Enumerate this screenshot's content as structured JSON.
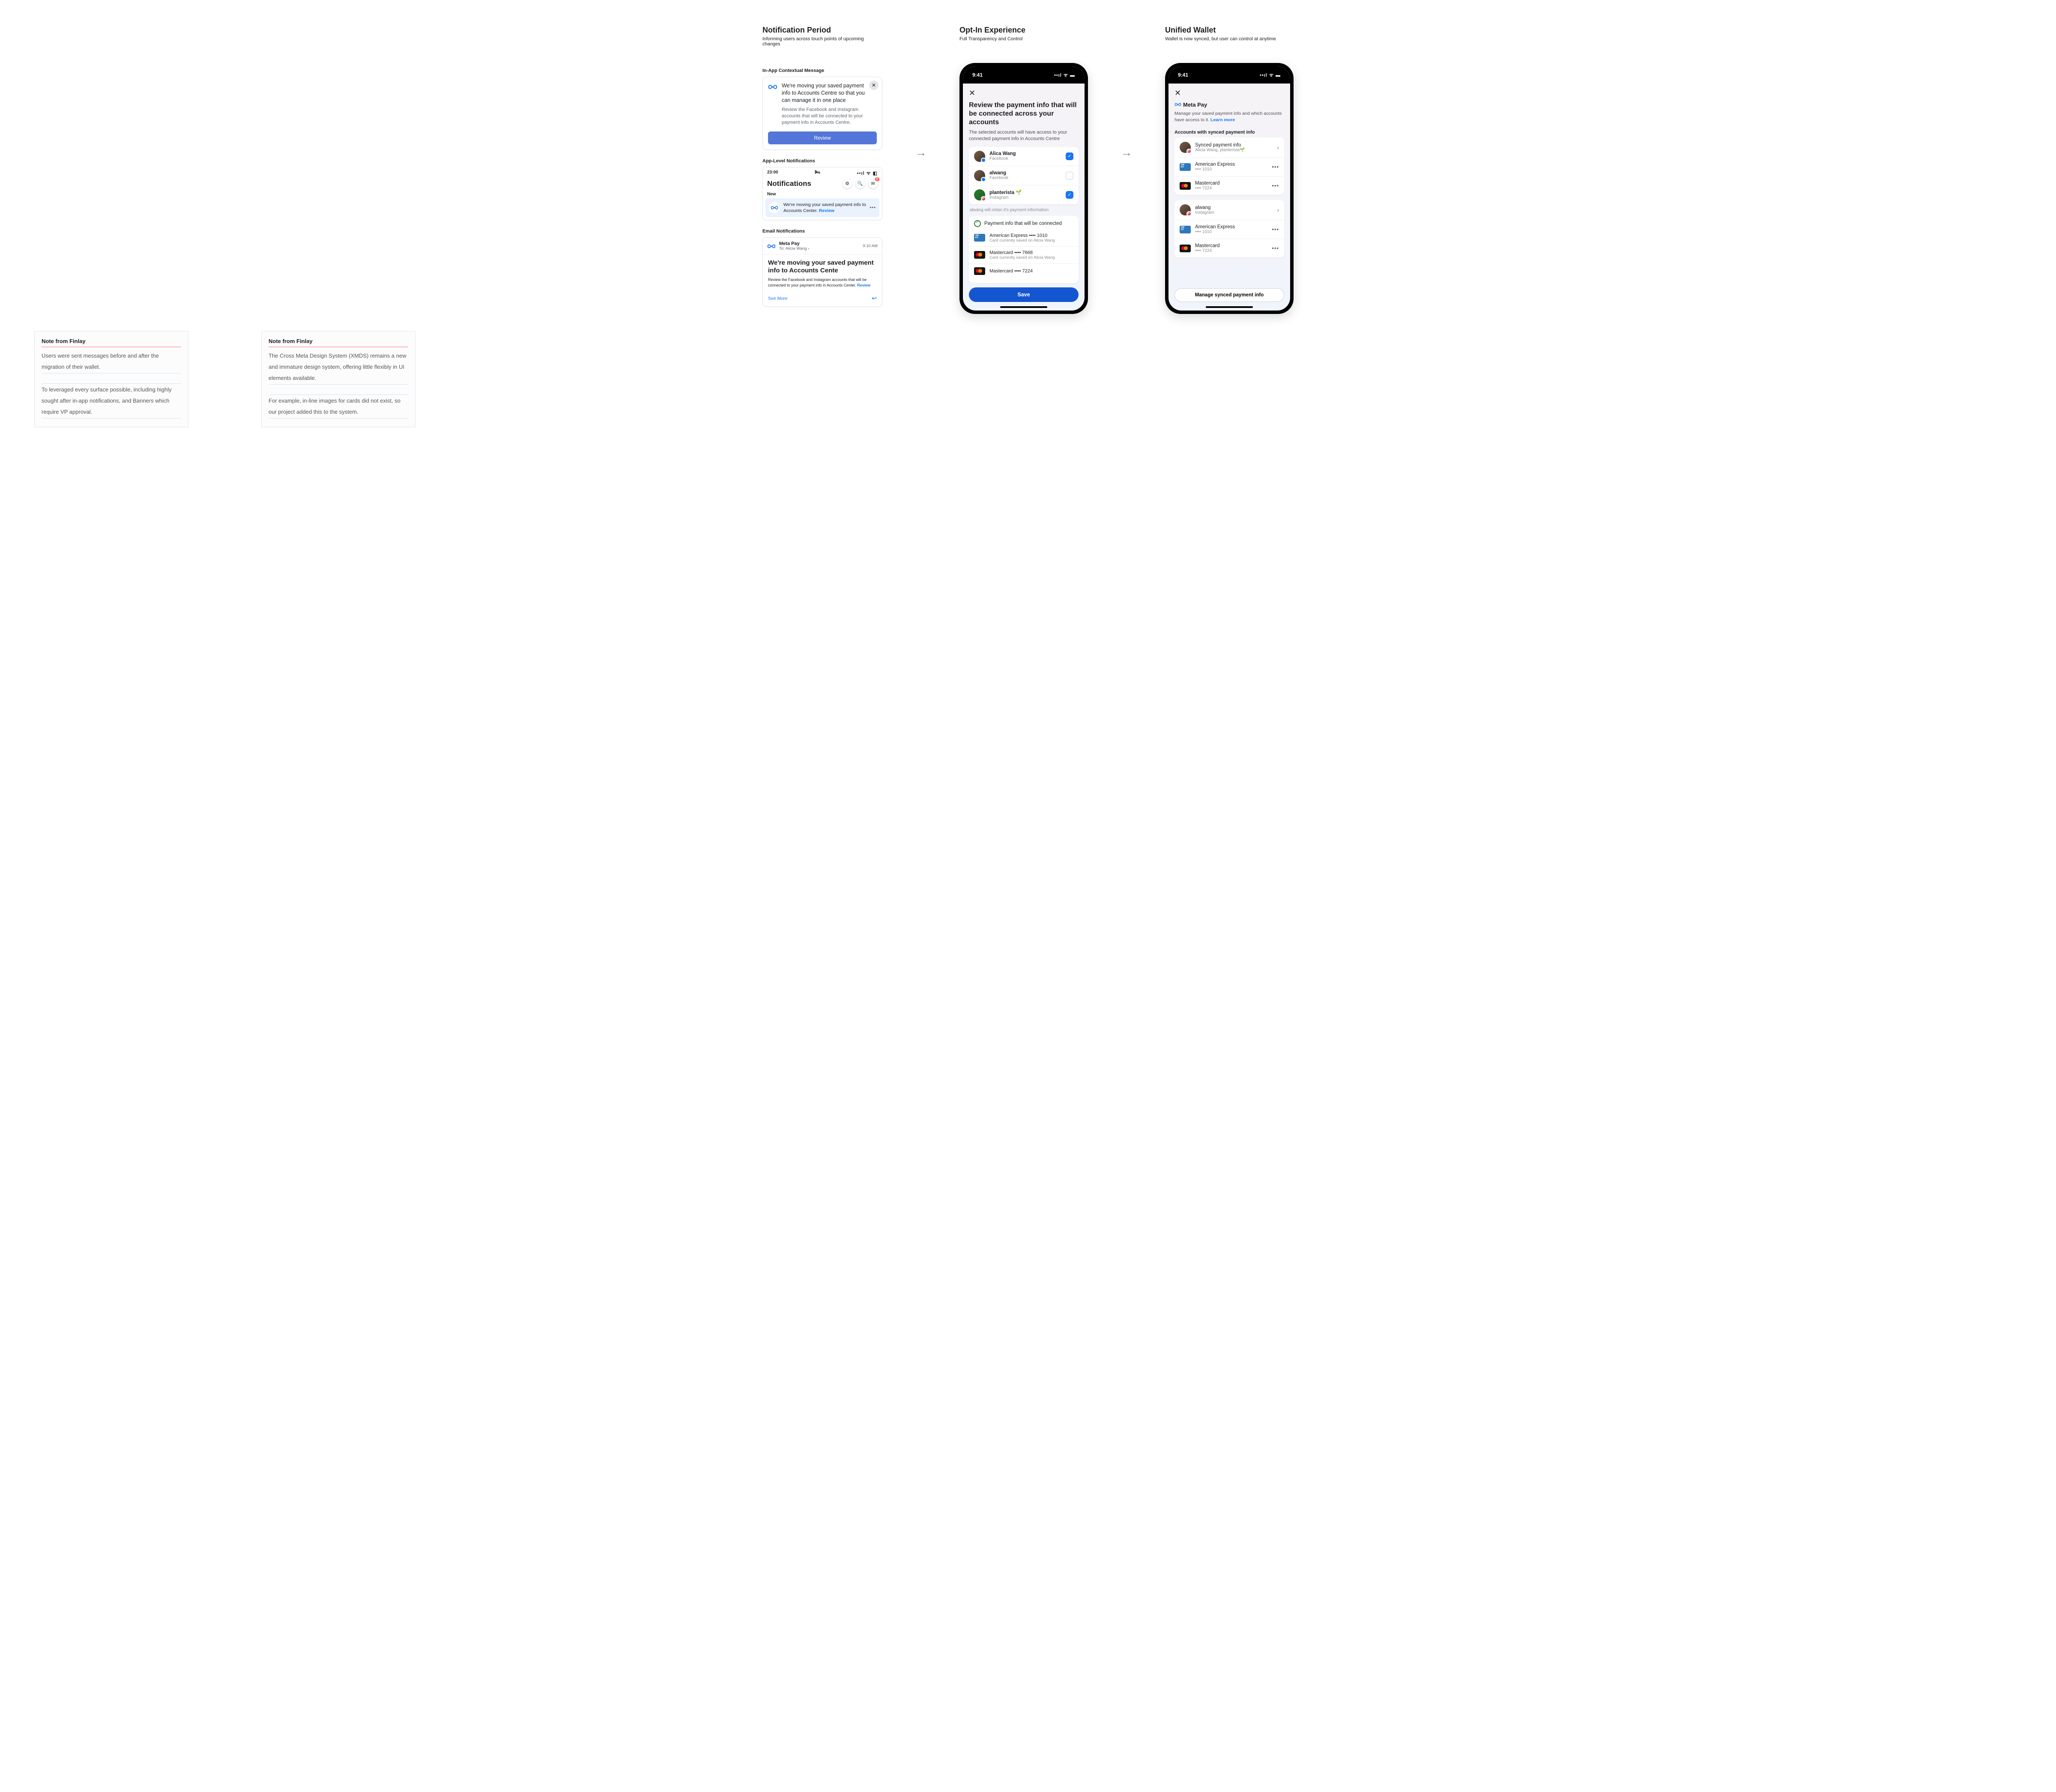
{
  "col1": {
    "title": "Notification Period",
    "subtitle": "Informing users across touch points of upcoming changes",
    "label_inapp": "In-App Contextual Message",
    "inapp": {
      "title": "We're moving your saved payment info to Accounts Centre so that you can manage it in one place",
      "body": "Review the Facebook and Instagram accounts that will be connected to your payment info in Accounts Centre.",
      "button": "Review"
    },
    "label_applevel": "App-Level Notifications",
    "notif_screen": {
      "time": "23:00",
      "header": "Notifications",
      "badge": "8",
      "new_label": "New",
      "text_prefix": "We're moving your saved payment info to Accounts Center. ",
      "review": "Review"
    },
    "label_email": "Email Notifications",
    "email": {
      "sender": "Meta Pay",
      "to_label": "To:",
      "to_name": "Alicia Wang",
      "time": "9:10 AM",
      "subject": "We're moving your saved payment info to Accounts Cente",
      "body_prefix": "Review the Facebook and Instagram accounts that will be connected to your payment info in Accounts Center. ",
      "body_link": "Review",
      "see_more": "See More"
    }
  },
  "col2": {
    "title": "Opt-In Experience",
    "subtitle": "Full Transparency and Control",
    "status_time": "9:41",
    "heading": "Review the payment info that will be connected across your accounts",
    "sub": "The selected accounts will have access to your connected payment info in Accounts Centre",
    "accounts": [
      {
        "name": "Alica Wang",
        "platform": "Facebook",
        "checked": true,
        "badge": "fb",
        "avatar": "brown"
      },
      {
        "name": "alwang",
        "platform": "Facebook",
        "checked": false,
        "badge": "fb",
        "avatar": "brown"
      },
      {
        "name": "planterista 🌱",
        "platform": "Instagram",
        "checked": true,
        "badge": "ig",
        "avatar": "green"
      }
    ],
    "retain_note": "alwang will retain it's payment information",
    "pay_heading": "Payment info that will be connected",
    "payments": [
      {
        "brand": "American Express",
        "last": "•••• 1010",
        "sub": "Card currently saved on Alicia Wang",
        "type": "amex"
      },
      {
        "brand": "Mastercard",
        "last": "•••• 7668",
        "sub": "Card currently saved on Alicia Wang",
        "type": "mc"
      },
      {
        "brand": "Mastercard",
        "last": "•••• 7224",
        "sub": "",
        "type": "mc"
      }
    ],
    "save_label": "Save"
  },
  "col3": {
    "title": "Unified Wallet",
    "subtitle": "Wallet is now synced, but user can control at anytime",
    "status_time": "9:41",
    "brand": "Meta Pay",
    "desc_prefix": "Manage your saved payment info and which accounts have access to it. ",
    "learn_more": "Learn more",
    "section_label": "Accounts with synced payment info",
    "group1_header": {
      "title": "Synced payment info",
      "sub": "Alicia Wang, planterista🌱"
    },
    "group1_cards": [
      {
        "brand": "American Express",
        "last": "•••• 1010",
        "type": "amex"
      },
      {
        "brand": "Mastercard",
        "last": "•••• 7224",
        "type": "mc"
      }
    ],
    "group2_header": {
      "title": "alwang",
      "sub": "Instagram"
    },
    "group2_cards": [
      {
        "brand": "American Express",
        "last": "•••• 1010",
        "type": "amex"
      },
      {
        "brand": "Mastercard",
        "last": "•••• 7224",
        "type": "mc"
      }
    ],
    "manage_label": "Manage synced payment info"
  },
  "notes": {
    "title": "Note from Finlay",
    "left": {
      "p1": "Users were sent messages before and after the migration of their wallet.",
      "p2": "To leveraged every surface possible, including highly sought after in-app notifications, and Banners which require VP approval."
    },
    "right": {
      "p1": "The Cross Meta Design System (XMDS) remains a new and immature design system, offering little flexibly in UI elements available.",
      "p2": "For example, in-line images for cards did not exist, so our project added this to the system."
    }
  }
}
